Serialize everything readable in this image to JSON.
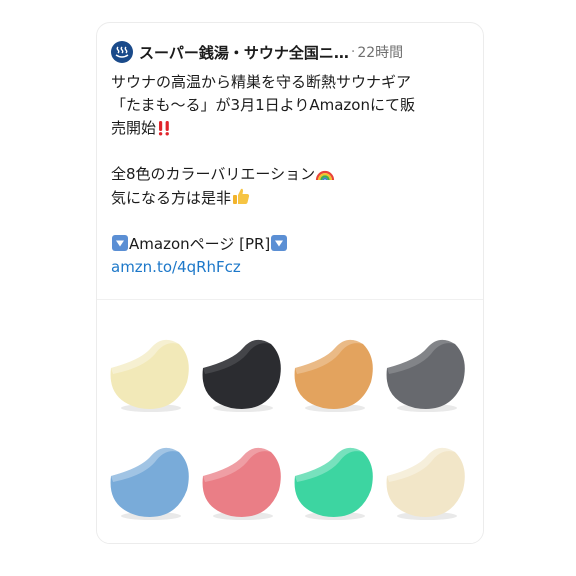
{
  "post": {
    "account_name": "スーパー銭湯・サウナ全国ニ…",
    "separator": "·",
    "time": "22時間",
    "lines": [
      "サウナの高温から精巣を守る断熱サウナギア",
      "「たまも〜る」が3月1日よりAmazonにて販",
      "売開始",
      "全8色のカラーバリエーション",
      "気になる方は是非",
      "Amazonページ [PR]"
    ],
    "link": "amzn.to/4qRhFcz"
  },
  "icons": {
    "avatar": "hot-springs-icon",
    "sale": "double-exclamation-emoji",
    "colors": "rainbow-emoji",
    "recommend": "thumbs-up-emoji",
    "arrow": "down-arrow-button-emoji"
  },
  "product_colors": [
    "#f2e9b8",
    "#2b2c30",
    "#e3a35e",
    "#67696e",
    "#79abd9",
    "#ea7e86",
    "#3dd5a1",
    "#f2e6c8"
  ]
}
